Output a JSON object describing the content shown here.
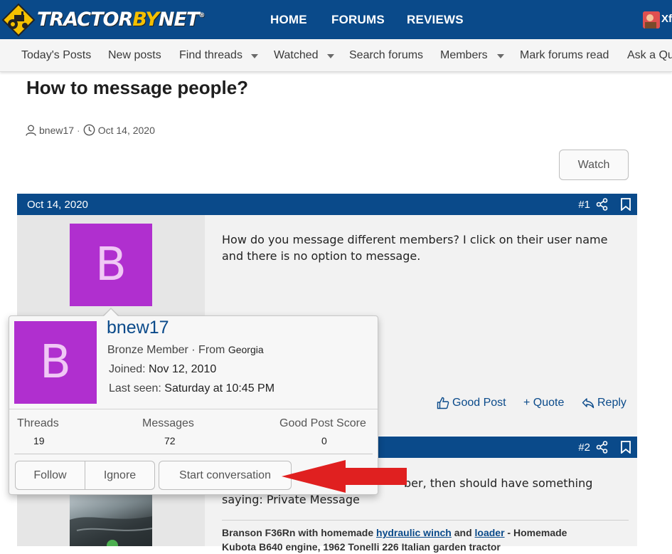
{
  "header": {
    "logo_text_a": "TRACTOR",
    "logo_text_b": "BY",
    "logo_text_c": "NET",
    "logo_tm": "®",
    "nav": [
      "HOME",
      "FORUMS",
      "REVIEWS"
    ],
    "corner_label": "Xf"
  },
  "subnav": {
    "items": [
      "Today's Posts",
      "New posts",
      "Find threads",
      "Watched",
      "Search forums",
      "Members",
      "Mark forums read",
      "Ask a Qu"
    ]
  },
  "thread": {
    "title": "How to message people?",
    "author": "bnew17",
    "separator": "·",
    "date": "Oct 14, 2020",
    "watch_label": "Watch"
  },
  "post1": {
    "date": "Oct 14, 2020",
    "number": "#1",
    "avatar_letter": "B",
    "text": "How do you message different members? I click on their user name and there is no option to message.",
    "actions": {
      "good_post": "Good Post",
      "quote": "+ Quote",
      "reply": "Reply"
    }
  },
  "post2": {
    "number": "#2",
    "text_line1": "ber, then should have something",
    "text_line2": "saying: Private Message",
    "signature": {
      "prefix": "Branson F36Rn with homemade ",
      "link1": "hydraulic winch",
      "mid": " and ",
      "link2": "loader",
      "suffix": " - Homemade",
      "line2": "Kubota B640 engine, 1962 Tonelli 226 Italian garden tractor"
    }
  },
  "member_card": {
    "avatar_letter": "B",
    "username": "bnew17",
    "role": "Bronze Member",
    "from_label": "· From",
    "from_value": "Georgia",
    "joined_label": "Joined:",
    "joined_value": "Nov 12, 2010",
    "last_seen_label": "Last seen:",
    "last_seen_value": "Saturday at 10:45 PM",
    "stats": [
      {
        "label": "Threads",
        "value": "19"
      },
      {
        "label": "Messages",
        "value": "72"
      },
      {
        "label": "Good Post Score",
        "value": "0"
      }
    ],
    "buttons": {
      "follow": "Follow",
      "ignore": "Ignore",
      "start_conversation": "Start conversation"
    }
  },
  "colors": {
    "brand_blue": "#0a4a8a",
    "logo_yellow": "#f5c000",
    "avatar_purple": "#b02fcf",
    "annotation_red": "#e02020"
  }
}
